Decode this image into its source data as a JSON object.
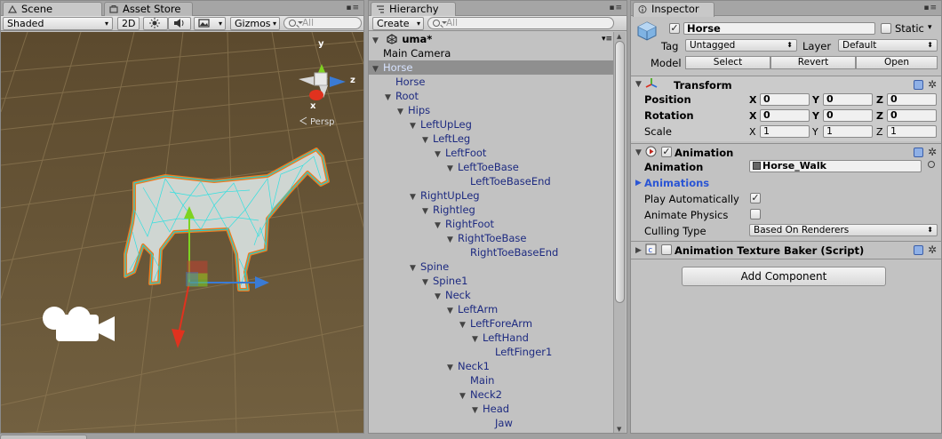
{
  "scene": {
    "tabs": [
      "Scene",
      "Asset Store"
    ],
    "toolbar": {
      "shading": "Shaded",
      "mode_2d": "2D",
      "gizmos": "Gizmos",
      "search_placeholder": "All"
    },
    "gizmo": {
      "y": "y",
      "x": "x",
      "z": "z",
      "persp": "Persp"
    },
    "colors": {
      "ground": "#6e5a3a",
      "sky": "#5d4a2c",
      "grid": "#8a7450",
      "mesh": "#35d8d8",
      "outline": "#f07a1e"
    }
  },
  "hierarchy": {
    "tab": "Hierarchy",
    "create": "Create",
    "search_placeholder": "All",
    "scene_name": "uma*",
    "rows": [
      {
        "label": "Main Camera",
        "depth": 1,
        "arrow": "",
        "style": "black"
      },
      {
        "label": "Horse",
        "depth": 1,
        "arrow": "▼",
        "style": "sel"
      },
      {
        "label": "Horse",
        "depth": 2,
        "arrow": "",
        "style": ""
      },
      {
        "label": "Root",
        "depth": 2,
        "arrow": "▼",
        "style": ""
      },
      {
        "label": "Hips",
        "depth": 3,
        "arrow": "▼",
        "style": ""
      },
      {
        "label": "LeftUpLeg",
        "depth": 4,
        "arrow": "▼",
        "style": ""
      },
      {
        "label": "LeftLeg",
        "depth": 5,
        "arrow": "▼",
        "style": ""
      },
      {
        "label": "LeftFoot",
        "depth": 6,
        "arrow": "▼",
        "style": ""
      },
      {
        "label": "LeftToeBase",
        "depth": 7,
        "arrow": "▼",
        "style": ""
      },
      {
        "label": "LeftToeBaseEnd",
        "depth": 8,
        "arrow": "",
        "style": ""
      },
      {
        "label": "RightUpLeg",
        "depth": 4,
        "arrow": "▼",
        "style": ""
      },
      {
        "label": "Rightleg",
        "depth": 5,
        "arrow": "▼",
        "style": ""
      },
      {
        "label": "RightFoot",
        "depth": 6,
        "arrow": "▼",
        "style": ""
      },
      {
        "label": "RightToeBase",
        "depth": 7,
        "arrow": "▼",
        "style": ""
      },
      {
        "label": "RightToeBaseEnd",
        "depth": 8,
        "arrow": "",
        "style": ""
      },
      {
        "label": "Spine",
        "depth": 4,
        "arrow": "▼",
        "style": ""
      },
      {
        "label": "Spine1",
        "depth": 5,
        "arrow": "▼",
        "style": ""
      },
      {
        "label": "Neck",
        "depth": 6,
        "arrow": "▼",
        "style": ""
      },
      {
        "label": "LeftArm",
        "depth": 7,
        "arrow": "▼",
        "style": ""
      },
      {
        "label": "LeftForeArm",
        "depth": 8,
        "arrow": "▼",
        "style": ""
      },
      {
        "label": "LeftHand",
        "depth": 9,
        "arrow": "▼",
        "style": ""
      },
      {
        "label": "LeftFinger1",
        "depth": 10,
        "arrow": "",
        "style": ""
      },
      {
        "label": "Neck1",
        "depth": 7,
        "arrow": "▼",
        "style": ""
      },
      {
        "label": "Main",
        "depth": 8,
        "arrow": "",
        "style": ""
      },
      {
        "label": "Neck2",
        "depth": 8,
        "arrow": "▼",
        "style": ""
      },
      {
        "label": "Head",
        "depth": 9,
        "arrow": "▼",
        "style": ""
      },
      {
        "label": "Jaw",
        "depth": 10,
        "arrow": "",
        "style": ""
      }
    ]
  },
  "inspector": {
    "tab": "Inspector",
    "object_name": "Horse",
    "static_label": "Static",
    "tag_label": "Tag",
    "tag_value": "Untagged",
    "layer_label": "Layer",
    "layer_value": "Default",
    "model_label": "Model",
    "model_buttons": [
      "Select",
      "Revert",
      "Open"
    ],
    "transform": {
      "title": "Transform",
      "rows": [
        {
          "label": "Position",
          "bold": true,
          "x": "0",
          "y": "0",
          "z": "0"
        },
        {
          "label": "Rotation",
          "bold": true,
          "x": "0",
          "y": "0",
          "z": "0"
        },
        {
          "label": "Scale",
          "bold": false,
          "x": "1",
          "y": "1",
          "z": "1"
        }
      ],
      "axes": [
        "X",
        "Y",
        "Z"
      ]
    },
    "animation": {
      "title": "Animation",
      "animation_label": "Animation",
      "animation_value": "Horse_Walk",
      "animations_label": "Animations",
      "play_auto_label": "Play Automatically",
      "animate_physics_label": "Animate Physics",
      "culling_label": "Culling Type",
      "culling_value": "Based On Renderers"
    },
    "baker": {
      "title": "Animation Texture Baker (Script)"
    },
    "add_component": "Add Component"
  }
}
